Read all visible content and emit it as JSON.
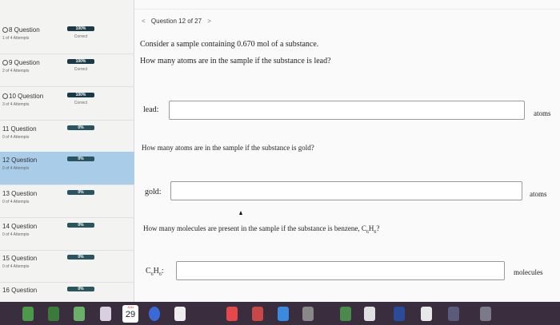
{
  "sidebar": {
    "questions": [
      {
        "title": "8 Question",
        "attempts": "1 of 4 Attempts",
        "score": "100%",
        "status": "Correct",
        "checked": true
      },
      {
        "title": "9 Question",
        "attempts": "2 of 4 Attempts",
        "score": "100%",
        "status": "Correct",
        "checked": true
      },
      {
        "title": "10 Question",
        "attempts": "3 of 4 Attempts",
        "score": "100%",
        "status": "Correct",
        "checked": true
      },
      {
        "title": "11 Question",
        "attempts": "0 of 4 Attempts",
        "score": "0%",
        "status": "",
        "checked": false
      },
      {
        "title": "12 Question",
        "attempts": "0 of 4 Attempts",
        "score": "0%",
        "status": "",
        "checked": false
      },
      {
        "title": "13 Question",
        "attempts": "0 of 4 Attempts",
        "score": "0%",
        "status": "",
        "checked": false
      },
      {
        "title": "14 Question",
        "attempts": "0 of 4 Attempts",
        "score": "0%",
        "status": "",
        "checked": false
      },
      {
        "title": "15 Question",
        "attempts": "0 of 4 Attempts",
        "score": "0%",
        "status": "",
        "checked": false
      },
      {
        "title": "16 Question",
        "attempts": "",
        "score": "0%",
        "status": "",
        "checked": false
      }
    ]
  },
  "main": {
    "nav": {
      "prev": "<",
      "label": "Question 12 of 27",
      "next": ">"
    },
    "intro": "Consider a sample containing 0.670 mol of a substance.",
    "q1": "How many atoms are in the sample if the substance is lead?",
    "lead_label": "lead:",
    "lead_value": "",
    "lead_unit": "atoms",
    "q2": "How many atoms are in the sample if the substance is gold?",
    "gold_label": "gold:",
    "gold_value": "",
    "gold_unit": "atoms",
    "q3_prefix": "How many molecules are present in the sample if the substance is benzene, C",
    "q3_sub1": "6",
    "q3_mid": "H",
    "q3_sub2": "6",
    "q3_suffix": "?",
    "benz_label_c": "C",
    "benz_label_sub1": "6",
    "benz_label_h": "H",
    "benz_label_sub2": "6",
    "benz_label_colon": ":",
    "benz_value": "",
    "benz_unit": "molecules"
  },
  "dock": {
    "calendar_month": "JUN",
    "calendar_day": "29"
  },
  "colors": {
    "active_row": "#a9cde8",
    "bar": "#1a3a4a",
    "dock": "#3a2d3e"
  }
}
